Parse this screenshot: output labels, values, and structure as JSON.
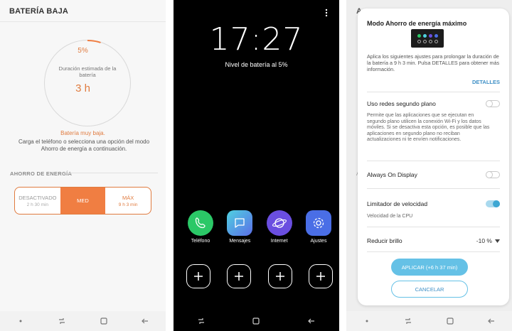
{
  "panel1": {
    "title": "BATERÍA BAJA",
    "battery_percent": "5%",
    "duration_label": "Duración estimada de la batería",
    "duration_value": "3 h",
    "low_battery": "Batería muy baja.",
    "low_battery_desc": "Carga el teléfono o selecciona una opción del modo Ahorro de energía a continuación.",
    "section_title": "AHORRO DE ENERGÍA",
    "modes": [
      {
        "label": "DESACTIVADO",
        "sub": "2 h 30 min"
      },
      {
        "label": "MED",
        "sub": ""
      },
      {
        "label": "MÁX",
        "sub": "9 h 3 min"
      }
    ],
    "accent_color": "#f07e42"
  },
  "panel2": {
    "time": "17:27",
    "battery_level": "Nivel de batería al 5%",
    "apps": [
      {
        "label": "Teléfono",
        "icon": "phone-icon"
      },
      {
        "label": "Mensajes",
        "icon": "message-icon"
      },
      {
        "label": "Internet",
        "icon": "internet-icon"
      },
      {
        "label": "Ajustes",
        "icon": "gear-icon"
      }
    ]
  },
  "panel3": {
    "background_title": "A",
    "background_hint": "A",
    "dialog_title": "Modo Ahorro de energía máximo",
    "dialog_desc": "Aplica los siguientes ajustes para prolongar la duración de la batería a 9 h 3 min. Pulsa DETALLES para obtener más información.",
    "details_link": "DETALLES",
    "bg_data_title": "Uso redes segundo plano",
    "bg_data_desc": "Permite que las aplicaciones que se ejecutan en segundo plano utilicen la conexión Wi-Fi y los datos móviles. Si se desactiva esta opción, es posible que las aplicaciones en segundo plano no reciban actualizaciones ni te envíen notificaciones.",
    "aod_title": "Always On Display",
    "speed_title": "Limitador de velocidad",
    "speed_desc": "Velocidad de la CPU",
    "brightness_title": "Reducir brillo",
    "brightness_value": "-10 %",
    "apply_button": "APLICAR (+6 h 37 min)",
    "cancel_button": "CANCELAR",
    "accent_color": "#3da7d3"
  }
}
